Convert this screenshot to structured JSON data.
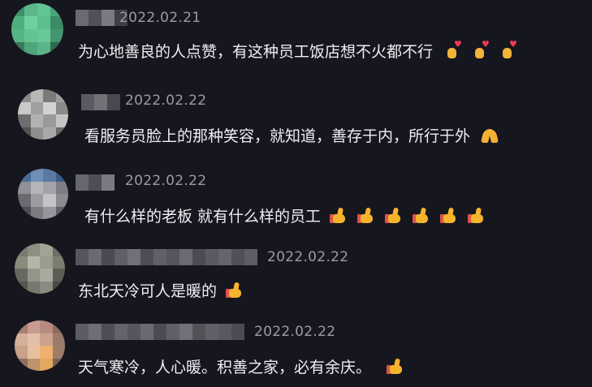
{
  "comments": [
    {
      "date": "2022.02.21",
      "text": "为心地善良的人点赞，有这种员工饭店想不火都不行",
      "emoji": {
        "name": "heart-hands-icon",
        "count": 3
      }
    },
    {
      "date": "2022.02.22",
      "text": "看服务员脸上的那种笑容，就知道，善存于内，所行于外",
      "emoji": {
        "name": "praying-hands-icon",
        "count": 1
      }
    },
    {
      "date": "2022.02.22",
      "text": "有什么样的老板 就有什么样的员工",
      "emoji": {
        "name": "thumbs-up-icon",
        "count": 6
      }
    },
    {
      "date": "2022.02.22",
      "text": "东北天冷可人是暖的",
      "emoji": {
        "name": "thumbs-up-icon",
        "count": 1
      }
    },
    {
      "date": "2022.02.22",
      "text": "天气寒冷，人心暖。积善之家，必有余庆。",
      "emoji": {
        "name": "thumbs-up-icon",
        "count": 1
      }
    }
  ],
  "colors": {
    "background": "#16161f",
    "text": "#eeeef2",
    "date": "#9b9ba4",
    "emoji_yellow": "#f5b42c",
    "emoji_red": "#e0524a"
  }
}
